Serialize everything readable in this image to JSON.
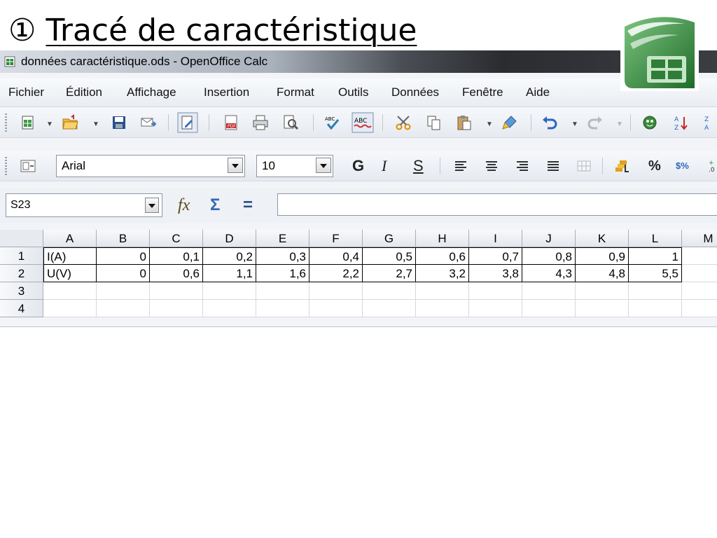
{
  "slide": {
    "number": "①",
    "title": "Tracé de caractéristique"
  },
  "window": {
    "title": "données caractéristique.ods - OpenOffice Calc"
  },
  "menu": [
    "Fichier",
    "Édition",
    "Affichage",
    "Insertion",
    "Format",
    "Outils",
    "Données",
    "Fenêtre",
    "Aide"
  ],
  "toolbar1": {
    "icons": [
      "new-document-icon",
      "open-folder-icon",
      "save-icon",
      "email-icon",
      "edit-file-icon",
      "export-pdf-icon",
      "print-icon",
      "page-preview-icon",
      "spellcheck-icon",
      "autospellcheck-icon",
      "cut-icon",
      "copy-icon",
      "paste-icon",
      "clone-formatting-icon",
      "undo-icon",
      "redo-icon",
      "navigator-icon",
      "sort-ascending-icon"
    ]
  },
  "toolbar2": {
    "font_name": "Arial",
    "font_size": "10",
    "bold_label": "G",
    "italic_label": "I",
    "underline_label": "S",
    "percent_label": "%",
    "currency_label": "$%"
  },
  "formula_bar": {
    "name_box": "S23",
    "function_wizard_label": "fx",
    "sum_label": "Σ",
    "equals_label": "=",
    "formula": ""
  },
  "sheet": {
    "columns": [
      "A",
      "B",
      "C",
      "D",
      "E",
      "F",
      "G",
      "H",
      "I",
      "J",
      "K",
      "L",
      "M"
    ],
    "rows": [
      {
        "row": "1",
        "cells": [
          "I(A)",
          "0",
          "0,1",
          "0,2",
          "0,3",
          "0,4",
          "0,5",
          "0,6",
          "0,7",
          "0,8",
          "0,9",
          "1",
          ""
        ]
      },
      {
        "row": "2",
        "cells": [
          "U(V)",
          "0",
          "0,6",
          "1,1",
          "1,6",
          "2,2",
          "2,7",
          "3,2",
          "3,8",
          "4,3",
          "4,8",
          "5,5",
          ""
        ]
      },
      {
        "row": "3",
        "cells": [
          "",
          "",
          "",
          "",
          "",
          "",
          "",
          "",
          "",
          "",
          "",
          "",
          ""
        ]
      },
      {
        "row": "4",
        "cells": [
          "",
          "",
          "",
          "",
          "",
          "",
          "",
          "",
          "",
          "",
          "",
          "",
          ""
        ]
      }
    ]
  },
  "colors": {
    "accent": "#3566b8",
    "logo_green": "#2e7d32"
  }
}
